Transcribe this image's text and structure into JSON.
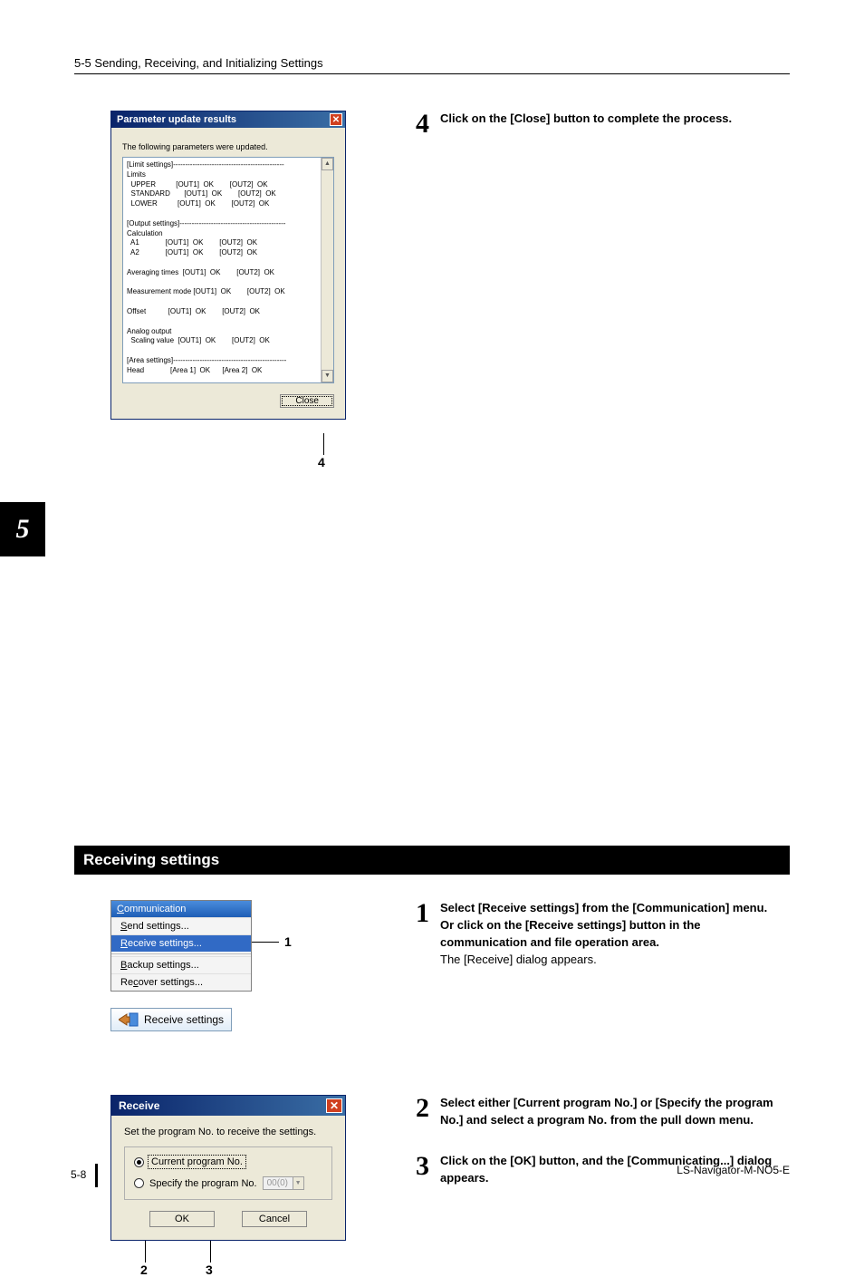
{
  "header": {
    "breadcrumb": "5-5 Sending, Receiving, and Initializing Settings"
  },
  "chapter": {
    "number": "5"
  },
  "step4": {
    "num": "4",
    "bold": "Click on the [Close] button to complete the process."
  },
  "param_dlg": {
    "title": "Parameter update results",
    "intro": "The following parameters were updated.",
    "close_label": "Close",
    "callout_num": "4",
    "results_text": "[Limit settings]----------------------------------------------\nLimits\n  UPPER          [OUT1]  OK        [OUT2]  OK\n  STANDARD       [OUT1]  OK        [OUT2]  OK\n  LOWER          [OUT1]  OK        [OUT2]  OK\n\n[Output settings]--------------------------------------------\nCalculation\n  A1             [OUT1]  OK        [OUT2]  OK\n  A2             [OUT1]  OK        [OUT2]  OK\n\nAveraging times  [OUT1]  OK        [OUT2]  OK\n\nMeasurement mode [OUT1]  OK        [OUT2]  OK\n\nOffset           [OUT1]  OK        [OUT2]  OK\n\nAnalog output\n  Scaling value  [OUT1]  OK        [OUT2]  OK\n\n[Area settings]-----------------------------------------------\nHead             [Area 1]  OK      [Area 2]  OK"
  },
  "section": {
    "title": "Receiving settings"
  },
  "menu": {
    "title": "Communication",
    "item_send": "Send settings...",
    "item_receive": "Receive settings...",
    "item_backup": "Backup settings...",
    "item_recover": "Recover settings...",
    "callout_num": "1"
  },
  "toolbtn": {
    "label": "Receive settings"
  },
  "step1": {
    "num": "1",
    "bold1": "Select [Receive settings] from the [Communication] menu.",
    "bold2": "Or click on the [Receive settings] button in the communication and file operation area.",
    "plain": "The [Receive] dialog appears."
  },
  "step2": {
    "num": "2",
    "bold": "Select either [Current program No.] or [Specify the program No.] and select a program No. from the pull down menu."
  },
  "step3": {
    "num": "3",
    "bold": "Click on the [OK] button, and the [Communicating...] dialog appears."
  },
  "receive_dlg": {
    "title": "Receive",
    "instruction": "Set the program No. to receive the settings.",
    "opt_current": "Current program No.",
    "opt_specify": "Specify the program No.",
    "combo_value": "00(0)",
    "ok": "OK",
    "cancel": "Cancel",
    "callout2": "2",
    "callout3": "3"
  },
  "footer": {
    "left": "5-8",
    "right": "LS-Navigator-M-NO5-E"
  }
}
